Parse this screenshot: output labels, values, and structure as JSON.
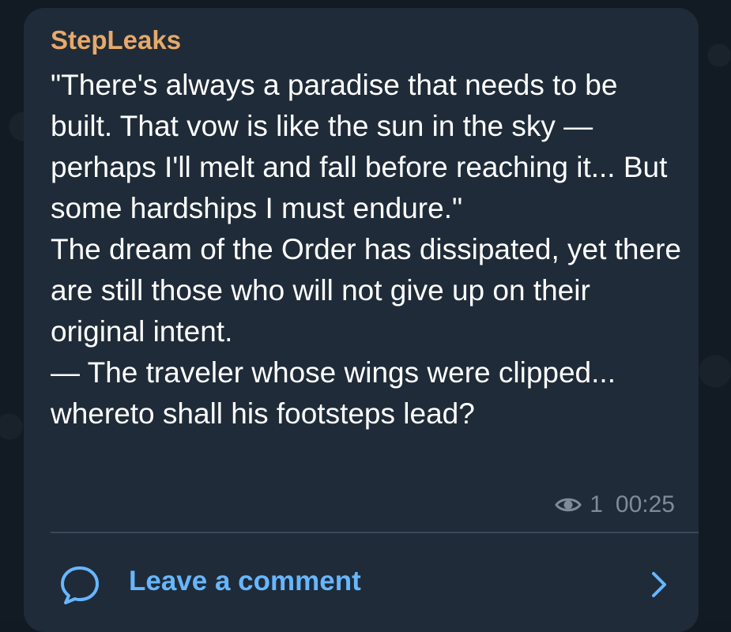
{
  "post": {
    "sender_name": "StepLeaks",
    "message_text": "\"There's always a paradise that needs to be built. That vow is like the sun in the sky — perhaps I'll melt and fall before reaching it... But some hardships I must endure.\"\nThe dream of the Order has dissipated, yet there are still those who will not give up on their original intent.\n— The traveler whose wings were clipped... whereto shall his footsteps lead?",
    "view_count": "1",
    "timestamp": "00:25"
  },
  "comments": {
    "label": "Leave a comment"
  },
  "colors": {
    "background": "#121a23",
    "bubble": "#1f2b38",
    "sender_name": "#e7a96a",
    "message_text": "#ffffff",
    "meta": "#7f8b98",
    "divider": "#39485a",
    "link_accent": "#67b6ff"
  },
  "icons": {
    "views": "eye-icon",
    "comment": "comment-bubble-icon",
    "navigate": "chevron-right-icon"
  }
}
